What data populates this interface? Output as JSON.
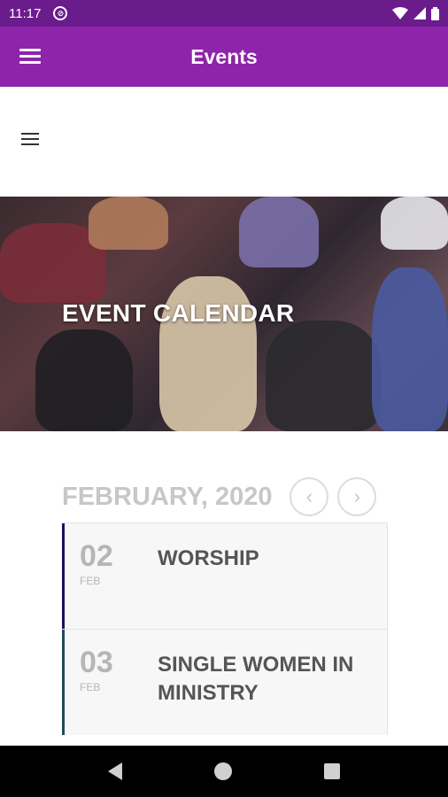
{
  "status_bar": {
    "time": "11:17"
  },
  "app_bar": {
    "title": "Events"
  },
  "hero": {
    "title": "EVENT CALENDAR"
  },
  "calendar": {
    "month": "FEBRUARY, 2020",
    "prev_icon": "chevron-left-icon",
    "next_icon": "chevron-right-icon",
    "events": [
      {
        "day": "02",
        "month": "FEB",
        "name": "WORSHIP",
        "accent": "#1a0f5c"
      },
      {
        "day": "03",
        "month": "FEB",
        "name": "SINGLE WOMEN IN MINISTRY",
        "accent": "#1f4b5a"
      }
    ]
  },
  "colors": {
    "status_bar": "#6a1b8c",
    "app_bar": "#8e24aa"
  }
}
